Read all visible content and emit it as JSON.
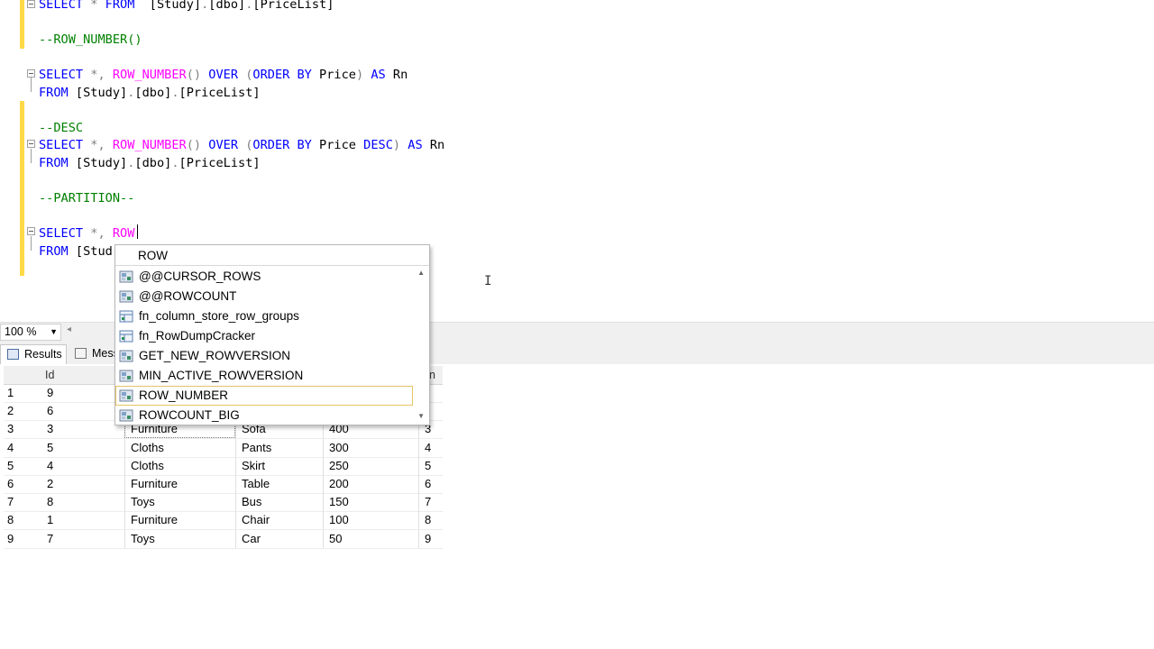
{
  "editor": {
    "lines": [
      {
        "tokens": [
          [
            "kw",
            "SELECT"
          ],
          [
            "op",
            " * "
          ],
          [
            "kw",
            "FROM"
          ],
          [
            "",
            "  [Study]"
          ],
          [
            "op",
            "."
          ],
          [
            "",
            "[dbo]"
          ],
          [
            "op",
            "."
          ],
          [
            "",
            "[PriceList]"
          ]
        ]
      },
      {
        "tokens": []
      },
      {
        "tokens": [
          [
            "cm",
            "--ROW_NUMBER()"
          ]
        ]
      },
      {
        "tokens": []
      },
      {
        "tokens": [
          [
            "kw",
            "SELECT"
          ],
          [
            "op",
            " *, "
          ],
          [
            "fn",
            "ROW_NUMBER"
          ],
          [
            "op",
            "() "
          ],
          [
            "kw",
            "OVER"
          ],
          [
            "op",
            " ("
          ],
          [
            "kw",
            "ORDER BY"
          ],
          [
            "",
            " Price"
          ],
          [
            "op",
            ")"
          ],
          [
            "kw",
            " AS"
          ],
          [
            "",
            " Rn"
          ]
        ]
      },
      {
        "tokens": [
          [
            "kw",
            "FROM"
          ],
          [
            "",
            " [Study]"
          ],
          [
            "op",
            "."
          ],
          [
            "",
            "[dbo]"
          ],
          [
            "op",
            "."
          ],
          [
            "",
            "[PriceList]"
          ]
        ]
      },
      {
        "tokens": []
      },
      {
        "tokens": [
          [
            "cm",
            "--DESC"
          ]
        ]
      },
      {
        "tokens": [
          [
            "kw",
            "SELECT"
          ],
          [
            "op",
            " *, "
          ],
          [
            "fn",
            "ROW_NUMBER"
          ],
          [
            "op",
            "() "
          ],
          [
            "kw",
            "OVER"
          ],
          [
            "op",
            " ("
          ],
          [
            "kw",
            "ORDER BY"
          ],
          [
            "",
            " Price "
          ],
          [
            "kw",
            "DESC"
          ],
          [
            "op",
            ")"
          ],
          [
            "kw",
            " AS"
          ],
          [
            "",
            " Rn"
          ]
        ]
      },
      {
        "tokens": [
          [
            "kw",
            "FROM"
          ],
          [
            "",
            " [Study]"
          ],
          [
            "op",
            "."
          ],
          [
            "",
            "[dbo]"
          ],
          [
            "op",
            "."
          ],
          [
            "",
            "[PriceList]"
          ]
        ]
      },
      {
        "tokens": []
      },
      {
        "tokens": [
          [
            "cm",
            "--PARTITION--"
          ]
        ]
      },
      {
        "tokens": []
      },
      {
        "tokens": [
          [
            "kw",
            "SELECT"
          ],
          [
            "op",
            " *, "
          ],
          [
            "fn",
            "ROW"
          ]
        ]
      },
      {
        "tokens": [
          [
            "kw",
            "FROM"
          ],
          [
            "",
            " [Stud"
          ]
        ]
      }
    ],
    "ibeam_glyph": "I"
  },
  "status": {
    "zoom": "100 %",
    "zoom_arrow": "▼",
    "scroll_left": "◂"
  },
  "tabs": {
    "results": "Results",
    "messages": "Mess"
  },
  "grid": {
    "headers": [
      "Id",
      "n"
    ],
    "rows": [
      {
        "num": "1",
        "id": "9",
        "cat": "",
        "item": "",
        "price": "",
        "rn": ""
      },
      {
        "num": "2",
        "id": "6",
        "cat": "",
        "item": "",
        "price": "",
        "rn": ""
      },
      {
        "num": "3",
        "id": "3",
        "cat": "Furniture",
        "item": "Sofa",
        "price": "400",
        "rn": "3"
      },
      {
        "num": "4",
        "id": "5",
        "cat": "Cloths",
        "item": "Pants",
        "price": "300",
        "rn": "4"
      },
      {
        "num": "5",
        "id": "4",
        "cat": "Cloths",
        "item": "Skirt",
        "price": "250",
        "rn": "5"
      },
      {
        "num": "6",
        "id": "2",
        "cat": "Furniture",
        "item": "Table",
        "price": "200",
        "rn": "6"
      },
      {
        "num": "7",
        "id": "8",
        "cat": "Toys",
        "item": "Bus",
        "price": "150",
        "rn": "7"
      },
      {
        "num": "8",
        "id": "1",
        "cat": "Furniture",
        "item": "Chair",
        "price": "100",
        "rn": "8"
      },
      {
        "num": "9",
        "id": "7",
        "cat": "Toys",
        "item": "Car",
        "price": "50",
        "rn": "9"
      }
    ]
  },
  "autocomplete": {
    "typed": "ROW",
    "items": [
      {
        "label": "@@CURSOR_ROWS",
        "icon": "system-function-icon"
      },
      {
        "label": "@@ROWCOUNT",
        "icon": "system-function-icon"
      },
      {
        "label": "fn_column_store_row_groups",
        "icon": "table-function-icon"
      },
      {
        "label": "fn_RowDumpCracker",
        "icon": "table-function-icon"
      },
      {
        "label": "GET_NEW_ROWVERSION",
        "icon": "system-function-icon"
      },
      {
        "label": "MIN_ACTIVE_ROWVERSION",
        "icon": "system-function-icon"
      },
      {
        "label": "ROW_NUMBER",
        "icon": "system-function-icon",
        "selected": true
      },
      {
        "label": "ROWCOUNT_BIG",
        "icon": "system-function-icon"
      }
    ],
    "scroll_up": "▲",
    "scroll_down": "▼"
  }
}
